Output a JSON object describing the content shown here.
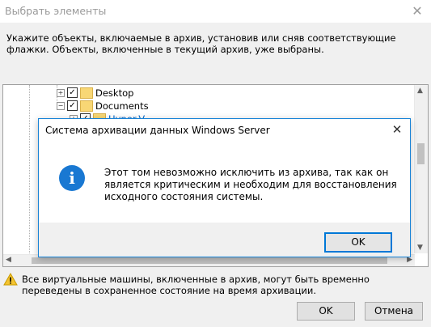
{
  "window": {
    "title": "Выбрать элементы",
    "close_glyph": "✕"
  },
  "instruction": "Укажите объекты, включаемые в архив, установив или сняв соответствующие флажки. Объекты, включенные в текущий архив, уже выбраны.",
  "tree": {
    "items": [
      {
        "label": "Desktop",
        "expander": "+",
        "checked": true
      },
      {
        "label": "Documents",
        "expander": "−",
        "checked": true
      },
      {
        "label": "Hyper-V",
        "expander": "+",
        "checked": true
      }
    ]
  },
  "dialog": {
    "title": "Система архивации данных Windows Server",
    "close_glyph": "✕",
    "icon": "info-icon",
    "icon_glyph": "i",
    "message": "Этот том невозможно исключить из архива, так как он является критическим и необходим для восстановления исходного состояния системы.",
    "ok_label": "OK"
  },
  "warning": {
    "icon": "warning-icon",
    "text": "Все виртуальные машины, включенные в архив, могут быть временно переведены в сохраненное состояние на время архивации."
  },
  "buttons": {
    "ok": "OK",
    "cancel": "Отмена"
  },
  "colors": {
    "accent": "#0078d7",
    "info_icon": "#1978d2",
    "warning_icon": "#f4c430"
  }
}
